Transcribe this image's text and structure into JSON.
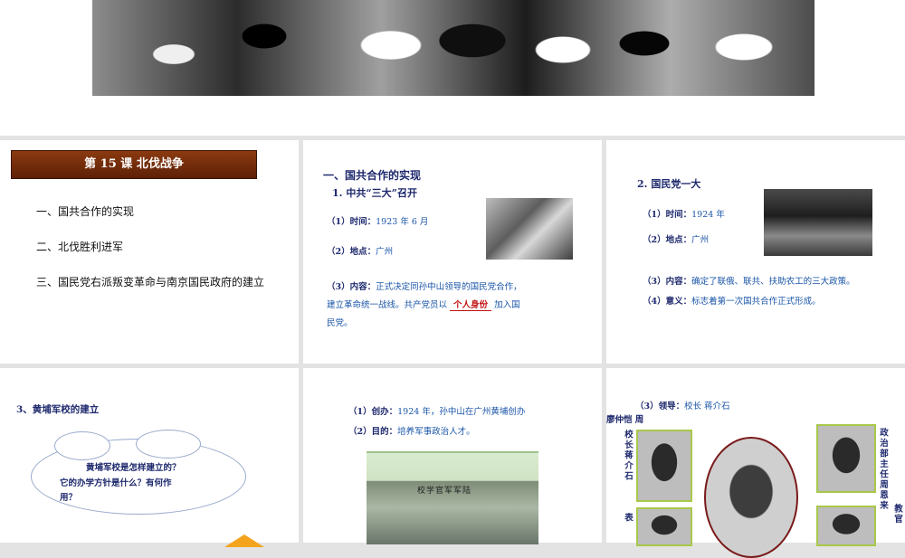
{
  "panel1": {
    "lesson_title": "第 15 课  北伐战争",
    "items": [
      "一、国共合作的实现",
      "二、北伐胜利进军",
      "三、国民党右派叛变革命与南京国民政府的建立"
    ]
  },
  "panel2": {
    "heading": "一、国共合作的实现",
    "subheading": "1. 中共“三大”召开",
    "time_label": "（1）时间：",
    "time_value": "1923 年 6 月",
    "place_label": "（2）地点：",
    "place_value": "广州",
    "content_label": "（3）内容：",
    "content_line1": "正式决定同孙中山领导的国民党合作，",
    "content_line2": "建立革命统一战线。共产党员以",
    "content_blank": "个人身份",
    "content_line2b": "加入国",
    "content_line3": "民党。"
  },
  "panel3": {
    "heading": "2. 国民党一大",
    "time_label": "（1）时间：",
    "time_value": "1924 年",
    "place_label": "（2）地点：",
    "place_value": "广州",
    "content_label": "（3）内容：",
    "content_value": "确定了联俄、联共、扶助农工的三大政策。",
    "meaning_label": "（4）意义：",
    "meaning_value": "标志着第一次国共合作正式形成。"
  },
  "panel4": {
    "heading": "3、黄埔军校的建立",
    "question_line1": "黄埔军校是怎样建立的？",
    "question_line2": "它的办学方针是什么？有何作",
    "question_line3": "用？"
  },
  "panel5": {
    "founding_label": "（1）创办：",
    "founding_value": "1924 年，孙中山在广州黄埔创办",
    "purpose_label": "（2）目的：",
    "purpose_value": "培养军事政治人才。",
    "gate_sign": "校学官军军陆"
  },
  "panel6": {
    "leaders_label": "（3）领导：",
    "leaders_value": "校长  蒋介石",
    "leaders_value2": "廖仲恺  周",
    "left_caption1": "校长蒋介石",
    "left_caption2": "党代表",
    "right_caption": "政治部主任周恩来",
    "right_caption2": "教官"
  }
}
